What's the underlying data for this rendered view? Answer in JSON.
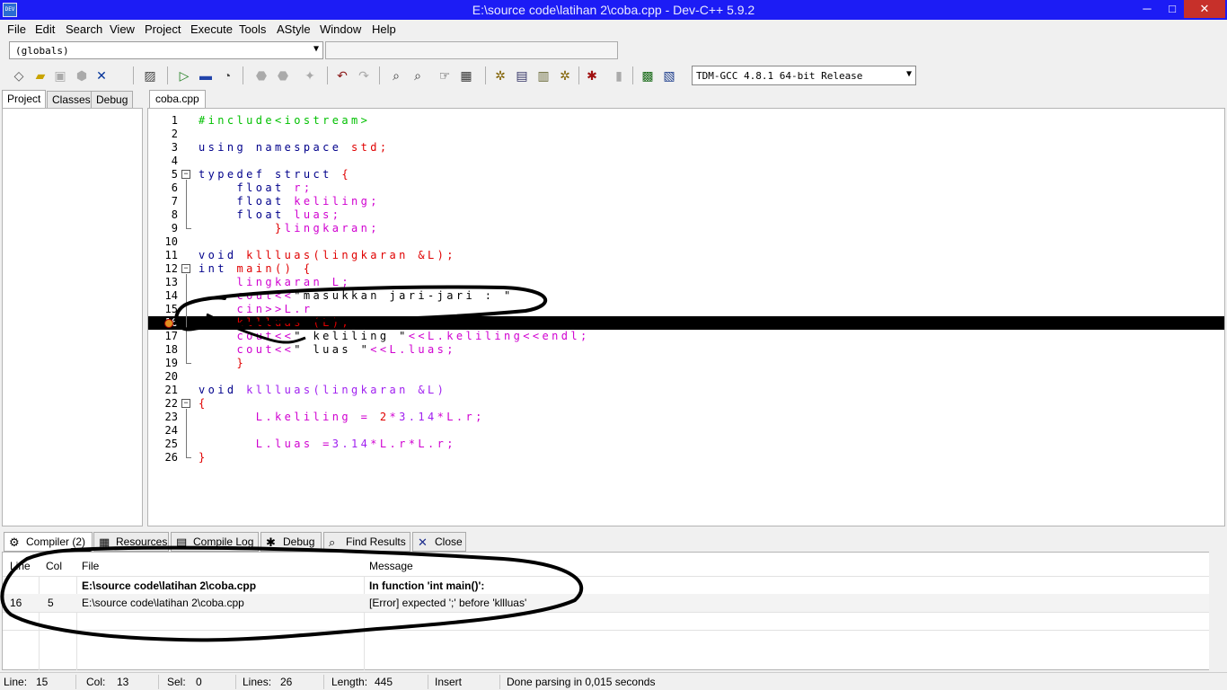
{
  "window": {
    "title": "E:\\source code\\latihan 2\\coba.cpp - Dev-C++ 5.9.2",
    "app_icon_text": "DEV",
    "min_glyph": "─",
    "max_glyph": "□",
    "close_glyph": "✕"
  },
  "menu": [
    "File",
    "Edit",
    "Search",
    "View",
    "Project",
    "Execute",
    "Tools",
    "AStyle",
    "Window",
    "Help"
  ],
  "globals_combo": {
    "value": "(globals)"
  },
  "toolbar": {
    "compiler": "TDM-GCC 4.8.1 64-bit Release",
    "icons": [
      "new-file-icon",
      "open-folder-icon",
      "save-icon",
      "save-all-icon",
      "close-file-icon",
      "print-icon",
      "compile-run-icon",
      "compile-icon",
      "clean-icon",
      "debug-icon",
      "stop-icon",
      "undo-icon",
      "redo-icon",
      "find-icon",
      "replace-icon",
      "goto-icon",
      "toggle-bookmark-icon",
      "new-class-icon",
      "add-file-icon",
      "remove-file-icon",
      "project-options-icon",
      "profile-icon",
      "abort-icon",
      "check-icon",
      "cpu-window-icon",
      "chart-icon"
    ]
  },
  "left_tabs": [
    "Project",
    "Classes",
    "Debug"
  ],
  "editor": {
    "file_tab": "coba.cpp",
    "lines": [
      {
        "n": "1",
        "tokens": [
          [
            "pp",
            "#include<iostream>"
          ]
        ]
      },
      {
        "n": "2",
        "tokens": []
      },
      {
        "n": "3",
        "tokens": [
          [
            "k",
            "using namespace "
          ],
          [
            "r",
            "std;"
          ]
        ]
      },
      {
        "n": "4",
        "tokens": []
      },
      {
        "n": "5",
        "tokens": [
          [
            "k",
            "typedef struct "
          ],
          [
            "r",
            "{"
          ]
        ]
      },
      {
        "n": "6",
        "tokens": [
          [
            "s",
            "    "
          ],
          [
            "k",
            "float "
          ],
          [
            "m",
            "r;"
          ]
        ]
      },
      {
        "n": "7",
        "tokens": [
          [
            "s",
            "    "
          ],
          [
            "k",
            "float "
          ],
          [
            "m",
            "keliling;"
          ]
        ]
      },
      {
        "n": "8",
        "tokens": [
          [
            "s",
            "    "
          ],
          [
            "k",
            "float "
          ],
          [
            "m",
            "luas;"
          ]
        ]
      },
      {
        "n": "9",
        "tokens": [
          [
            "s",
            "        "
          ],
          [
            "r",
            "}"
          ],
          [
            "m",
            "lingkaran;"
          ]
        ]
      },
      {
        "n": "10",
        "tokens": []
      },
      {
        "n": "11",
        "tokens": [
          [
            "k",
            "void "
          ],
          [
            "r",
            "kllluas(lingkaran &L);"
          ]
        ]
      },
      {
        "n": "12",
        "tokens": [
          [
            "k",
            "int "
          ],
          [
            "r",
            "main() {"
          ]
        ]
      },
      {
        "n": "13",
        "tokens": [
          [
            "s",
            "    "
          ],
          [
            "m",
            "lingkaran L;"
          ]
        ]
      },
      {
        "n": "14",
        "tokens": [
          [
            "s",
            "    "
          ],
          [
            "m",
            "cout<<"
          ],
          [
            "s",
            "\"masukkan jari-jari : \""
          ]
        ]
      },
      {
        "n": "15",
        "tokens": [
          [
            "s",
            "    "
          ],
          [
            "m",
            "cin>>L.r"
          ]
        ]
      },
      {
        "n": "16",
        "tokens": [
          [
            "s",
            "    "
          ],
          [
            "r",
            "kllluas (L);"
          ]
        ]
      },
      {
        "n": "17",
        "tokens": [
          [
            "s",
            "    "
          ],
          [
            "m",
            "cout<<"
          ],
          [
            "s",
            "\" keliling \""
          ],
          [
            "m",
            "<<L.keliling<<endl;"
          ]
        ]
      },
      {
        "n": "18",
        "tokens": [
          [
            "s",
            "    "
          ],
          [
            "m",
            "cout<<"
          ],
          [
            "s",
            "\" luas \""
          ],
          [
            "m",
            "<<L.luas;"
          ]
        ]
      },
      {
        "n": "19",
        "tokens": [
          [
            "s",
            "    "
          ],
          [
            "r",
            "}"
          ]
        ]
      },
      {
        "n": "20",
        "tokens": []
      },
      {
        "n": "21",
        "tokens": [
          [
            "k",
            "void "
          ],
          [
            "n",
            "kllluas(lingkaran &L)"
          ]
        ]
      },
      {
        "n": "22",
        "tokens": [
          [
            "r",
            "{"
          ]
        ]
      },
      {
        "n": "23",
        "tokens": [
          [
            "s",
            "      "
          ],
          [
            "m",
            "L.keliling = "
          ],
          [
            "r",
            "2"
          ],
          [
            "m",
            "*"
          ],
          [
            "n",
            "3.14"
          ],
          [
            "m",
            "*L.r;"
          ]
        ]
      },
      {
        "n": "24",
        "tokens": []
      },
      {
        "n": "25",
        "tokens": [
          [
            "s",
            "      "
          ],
          [
            "m",
            "L.luas ="
          ],
          [
            "n",
            "3.14"
          ],
          [
            "m",
            "*L.r*L.r;"
          ]
        ]
      },
      {
        "n": "26",
        "tokens": [
          [
            "r",
            "}"
          ]
        ]
      }
    ]
  },
  "bottom_tabs": [
    {
      "label": "Compiler (2)",
      "icon": "compiler-icon",
      "glyph": "⚙"
    },
    {
      "label": "Resources",
      "icon": "resources-icon",
      "glyph": "▦"
    },
    {
      "label": "Compile Log",
      "icon": "compile-log-icon",
      "glyph": "▤"
    },
    {
      "label": "Debug",
      "icon": "debug-icon",
      "glyph": "✱"
    },
    {
      "label": "Find Results",
      "icon": "find-results-icon",
      "glyph": "⌕"
    },
    {
      "label": "Close",
      "icon": "close-icon",
      "glyph": "✕"
    }
  ],
  "messages": {
    "headers": [
      "Line",
      "Col",
      "File",
      "Message"
    ],
    "rows": [
      {
        "line": "",
        "col": "",
        "file": "E:\\source code\\latihan 2\\coba.cpp",
        "message": "In function 'int main()':",
        "bold": true
      },
      {
        "line": "16",
        "col": "5",
        "file": "E:\\source code\\latihan 2\\coba.cpp",
        "message": "[Error] expected ';' before 'kllluas'",
        "bold": false
      }
    ]
  },
  "status": {
    "line_label": "Line:",
    "line": "15",
    "col_label": "Col:",
    "col": "13",
    "sel_label": "Sel:",
    "sel": "0",
    "lines_label": "Lines:",
    "lines": "26",
    "length_label": "Length:",
    "length": "445",
    "mode": "Insert",
    "message": "Done parsing in 0,015 seconds"
  }
}
